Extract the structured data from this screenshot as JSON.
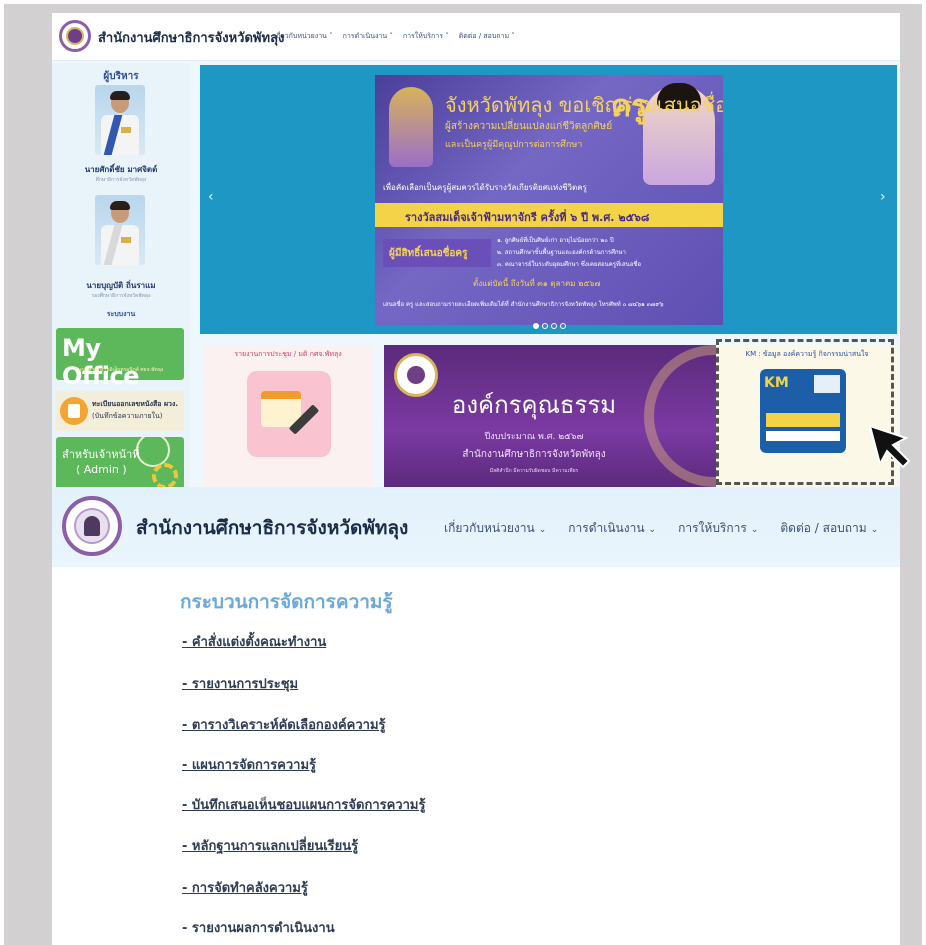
{
  "top_screenshot": {
    "site_title": "สำนักงานศึกษาธิการจังหวัดพัทลุง",
    "menu": [
      "เกี่ยวกับหน่วยงาน ˅",
      "การดำเนินงาน ˅",
      "การให้บริการ ˅",
      "ติดต่อ / สอบถาม ˅"
    ],
    "sidebar": {
      "heading": "ผู้บริหาร",
      "people": [
        {
          "name": "นายศักดิ์ชัย มาศจิตต์",
          "role": "ศึกษาธิการจังหวัดพัทลุง"
        },
        {
          "name": "นายบุญบัติ ถิ่นราแม",
          "role": "รองศึกษาธิการจังหวัดพัทลุง"
        }
      ],
      "systems_heading": "ระบบงาน",
      "myoffice_label": "My Office",
      "myoffice_caption": "ระบบสำนักงานอิเล็กทรอนิกส์ ศธจ.พัทลุง",
      "inbox_line1": "ทะเบียนออกเลขหนังสือ ผวง.",
      "inbox_line2": "(บันทึกข้อความภายใน)",
      "admin_line1": "สำหรับเจ้าหน้าที่",
      "admin_line2": "( Admin )"
    },
    "carousel": {
      "prev_arrow": "‹",
      "next_arrow": "›",
      "poster": {
        "headline": "จังหวัดพัทลุง ขอเชิญร่วมเสนอชื่อ...",
        "sub1": "ผู้สร้างความเปลี่ยนแปลงแก่ชีวิตลูกศิษย์",
        "sub2": "และเป็นครูผู้มีคุณูปการต่อการศึกษา",
        "khru": "ครู",
        "invite_line": "เพื่อคัดเลือกเป็นครูผู้สมควรได้รับรางวัลเกียรติยศแห่งชีวิตครู",
        "award": "รางวัลสมเด็จเจ้าฟ้ามหาจักรี ครั้งที่ ๖ ปี พ.ศ. ๒๕๖๘",
        "nominator": "ผู้มีสิทธิ์เสนอชื่อครู",
        "criteria": [
          "๑. ลูกศิษย์ที่เป็นศิษย์เก่า อายุไม่น้อยกว่า ๒๐ ปี",
          "๒. สถานศึกษาขั้นพื้นฐานและองค์กรด้านการศึกษา",
          "๓. คณาจารย์ในระดับอุดมศึกษา ซึ่งเคยสอนครูที่เสนอชื่อ"
        ],
        "since": "ตั้งแต่บัดนี้ ถึงวันที่ ๓๑ ตุลาคม ๒๕๖๗",
        "footer": "เสนอชื่อ ครู และสอบถามรายละเอียดเพิ่มเติมได้ที่ สำนักงานศึกษาธิการจังหวัดพัทลุง โทรศัพท์ ๐ ๗๔๖๑ ๓๗๙๖"
      }
    },
    "cards": {
      "meeting_title": "รายงานการประชุม / มติ กศจ.พัทลุง",
      "org_title": "องค์กรคุณธรรม",
      "org_year": "ปีงบประมาณ พ.ศ. ๒๕๖๗",
      "org_sub": "สำนักงานศึกษาธิการจังหวัดพัทลุง",
      "org_tag": "มีสติสำนึก มีความรับผิดชอบ มีความเพียร",
      "km_title": "KM : ข้อมูล องค์ความรู้ กิจกรรมน่าสนใจ",
      "km_badge": "KM"
    }
  },
  "bottom_screenshot": {
    "site_title": "สำนักงานศึกษาธิการจังหวัดพัทลุง",
    "menu": [
      {
        "label": "เกี่ยวกับหน่วยงาน",
        "chevron": "⌄"
      },
      {
        "label": "การดำเนินงาน",
        "chevron": "⌄"
      },
      {
        "label": "การให้บริการ",
        "chevron": "⌄"
      },
      {
        "label": "ติดต่อ / สอบถาม",
        "chevron": "⌄"
      }
    ],
    "page_heading": "กระบวนการจัดการความรู้",
    "links": [
      "- คำสั่งแต่งตั้งคณะทำงาน",
      "- รายงานการประชุม",
      "- ตารางวิเคราะห์คัดเลือกองค์ความรู้",
      "- แผนการจัดการความรู้",
      "- บันทึกเสนอเห็นชอบแผนการจัดการความรู้",
      "- หลักฐานการแลกเปลี่ยนเรียนรู้",
      "- การจัดทำคลังความรู้",
      "- รายงานผลการดำเนินงาน"
    ]
  },
  "colors": {
    "frame": "#d2d0d0",
    "carousel": "#1e97c4",
    "heading_blue": "#6aa9d8",
    "brand_green": "#5db85c",
    "brand_purple": "#7b3aa2"
  }
}
